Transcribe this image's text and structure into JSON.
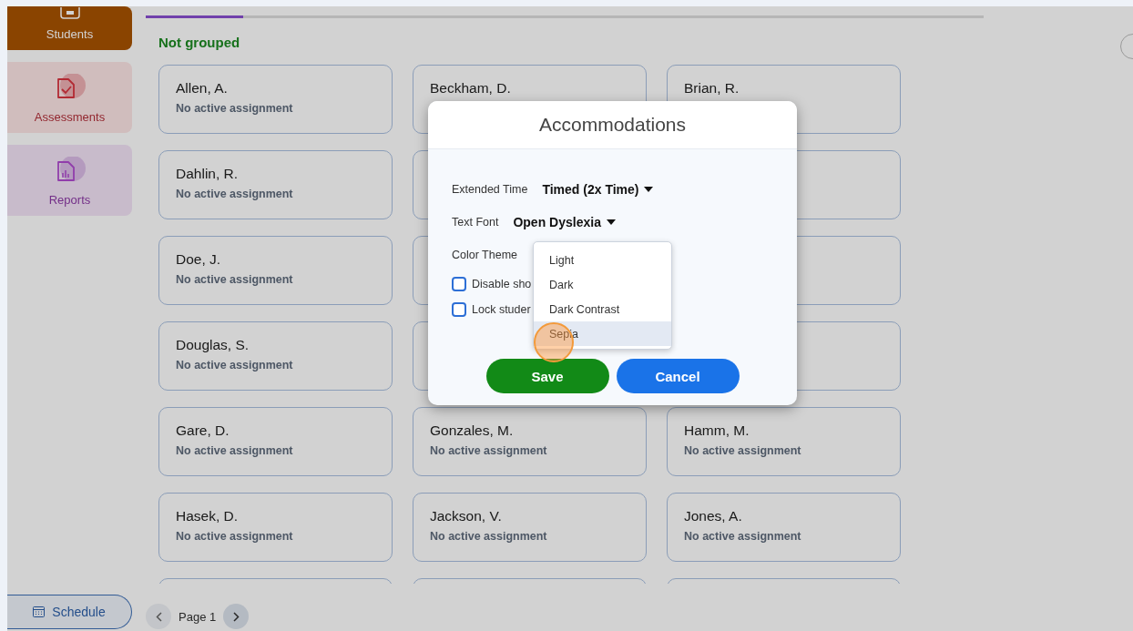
{
  "sidebar": {
    "items": [
      {
        "label": "Students",
        "kind": "students",
        "selected": true
      },
      {
        "label": "Assessments",
        "kind": "assessments",
        "selected": false
      },
      {
        "label": "Reports",
        "kind": "reports",
        "selected": false
      }
    ],
    "schedule_button": "Schedule"
  },
  "group_title": "Not grouped",
  "students": [
    {
      "kind": "card",
      "name": "Allen, A.",
      "status": "No active assignment"
    },
    {
      "kind": "card",
      "name": "Beckham, D."
    },
    {
      "kind": "card",
      "name": "Brian, R."
    },
    {
      "kind": "card",
      "name": "Dahlin, R.",
      "status": "No active assignment"
    },
    {
      "kind": "covered"
    },
    {
      "kind": "covered"
    },
    {
      "kind": "card",
      "name": "Doe, J.",
      "status": "No active assignment"
    },
    {
      "kind": "covered"
    },
    {
      "kind": "covered"
    },
    {
      "kind": "card",
      "name": "Douglas, S.",
      "status": "No active assignment"
    },
    {
      "kind": "covered"
    },
    {
      "kind": "covered"
    },
    {
      "kind": "card",
      "name": "Gare, D.",
      "status": "No active assignment"
    },
    {
      "kind": "card",
      "name": "Gonzales, M.",
      "status": "No active assignment"
    },
    {
      "kind": "card",
      "name": "Hamm, M.",
      "status": "No active assignment"
    },
    {
      "kind": "card",
      "name": "Hasek, D.",
      "status": "No active assignment"
    },
    {
      "kind": "card",
      "name": "Jackson, V.",
      "status": "No active assignment"
    },
    {
      "kind": "card",
      "name": "Jones, A.",
      "status": "No active assignment"
    },
    {
      "kind": "covered"
    },
    {
      "kind": "covered"
    },
    {
      "kind": "covered"
    }
  ],
  "pagination": {
    "label": "Page 1"
  },
  "dialog": {
    "title": "Accommodations",
    "fields": [
      {
        "label": "Extended Time",
        "value": "Timed (2x Time)"
      },
      {
        "label": "Text Font",
        "value": "Open Dyslexia"
      },
      {
        "label": "Color Theme"
      }
    ],
    "checkboxes": [
      {
        "label": "Disable sho",
        "checked": false
      },
      {
        "label": "Lock studer",
        "checked": false
      }
    ],
    "theme_options": [
      {
        "label": "Light",
        "selected": false
      },
      {
        "label": "Dark",
        "selected": false
      },
      {
        "label": "Dark Contrast",
        "selected": false
      },
      {
        "label": "Sepia",
        "selected": true
      }
    ],
    "buttons": [
      {
        "label": "Save",
        "kind": "primary"
      },
      {
        "label": "Cancel",
        "kind": "secondary"
      }
    ]
  }
}
